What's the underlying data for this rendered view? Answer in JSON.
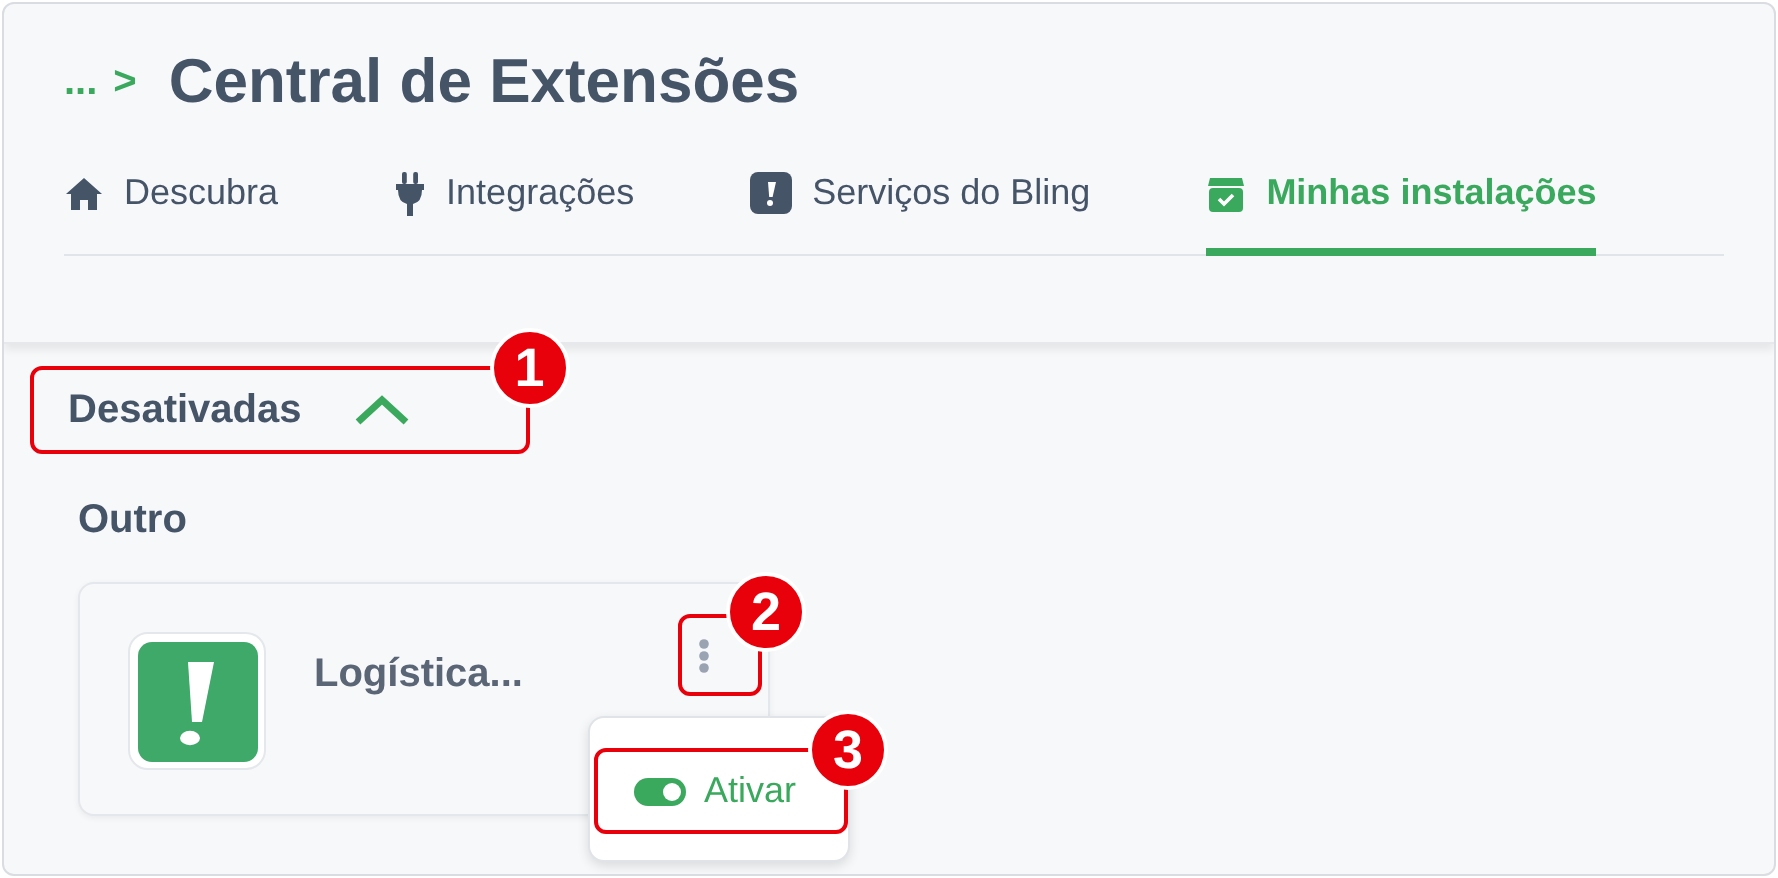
{
  "breadcrumb": {
    "ellipsis": "...",
    "separator": ">"
  },
  "title": "Central de Extensões",
  "tabs": [
    {
      "label": "Descubra",
      "selected": false
    },
    {
      "label": "Integrações",
      "selected": false
    },
    {
      "label": "Serviços do Bling",
      "selected": false
    },
    {
      "label": "Minhas instalações",
      "selected": true
    }
  ],
  "section": {
    "label": "Desativadas",
    "expanded": true
  },
  "group": {
    "label": "Outro"
  },
  "extension": {
    "name": "Logística..."
  },
  "menu": {
    "items": [
      {
        "label": "Ativar",
        "on": true
      }
    ]
  },
  "annotations": [
    {
      "label": "1"
    },
    {
      "label": "2"
    },
    {
      "label": "3"
    }
  ]
}
